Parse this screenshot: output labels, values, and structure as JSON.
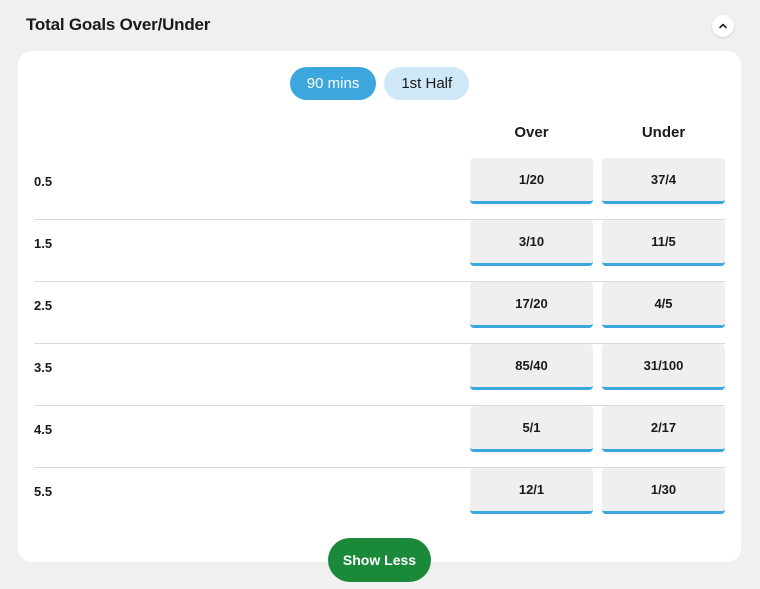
{
  "market": {
    "title": "Total Goals Over/Under",
    "collapse_icon": "chevron-up-icon"
  },
  "tabs": [
    {
      "label": "90 mins",
      "active": true
    },
    {
      "label": "1st Half",
      "active": false
    }
  ],
  "columns": {
    "over": "Over",
    "under": "Under"
  },
  "lines": [
    {
      "line": "0.5",
      "over": "1/20",
      "under": "37/4"
    },
    {
      "line": "1.5",
      "over": "3/10",
      "under": "11/5"
    },
    {
      "line": "2.5",
      "over": "17/20",
      "under": "4/5"
    },
    {
      "line": "3.5",
      "over": "85/40",
      "under": "31/100"
    },
    {
      "line": "4.5",
      "over": "5/1",
      "under": "2/17"
    },
    {
      "line": "5.5",
      "over": "12/1",
      "under": "1/30"
    }
  ],
  "show_less_label": "Show Less",
  "colors": {
    "accent": "#3ba7dd",
    "tab_inactive": "#cfe8f7",
    "show_less": "#1a8a3a",
    "odds_button": "#efefef"
  }
}
